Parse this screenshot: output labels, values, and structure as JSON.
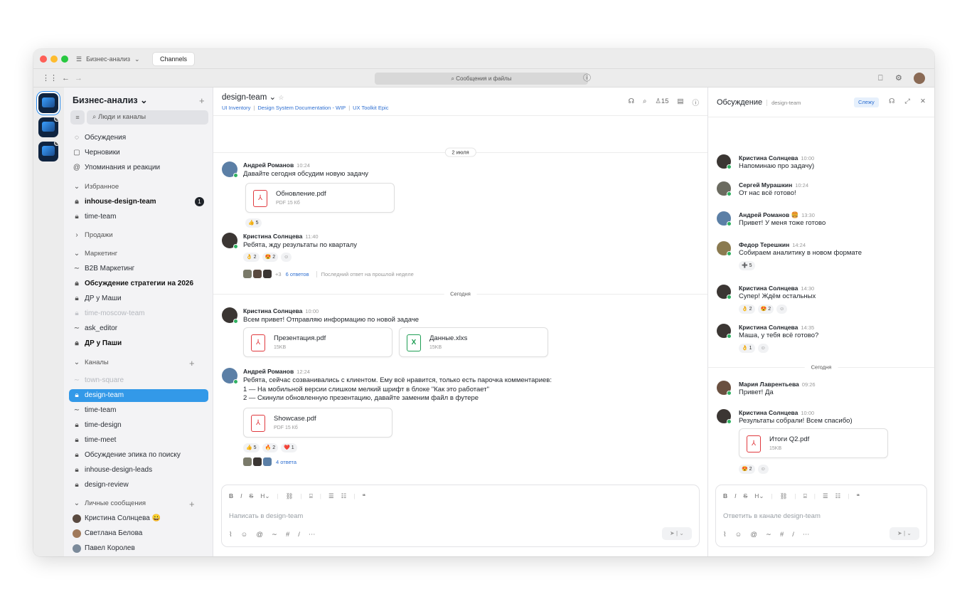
{
  "titlebar": {
    "workspace": "Бизнес-анализ",
    "tab": "Channels"
  },
  "toolbar": {
    "search_placeholder": "Сообщения и файлы"
  },
  "sidebar": {
    "title": "Бизнес-анализ",
    "search_placeholder": "Люди и каналы",
    "top": [
      "Обсуждения",
      "Черновики",
      "Упоминания и реакции"
    ],
    "favorites_label": "Избранное",
    "favorites": [
      {
        "label": "inhouse-design-team",
        "badge": "1"
      },
      {
        "label": "time-team"
      }
    ],
    "sales_label": "Продажи",
    "marketing_label": "Маркетинг",
    "marketing": [
      "B2B Маркетинг",
      "Обсуждение стратегии на 2026",
      "ДР у Маши",
      "time-moscow-team",
      "ask_editor",
      "ДР у Паши"
    ],
    "channels_label": "Каналы",
    "channels": [
      "town-square",
      "design-team",
      "time-team",
      "time-design",
      "time-meet",
      "Обсуждение эпика по поиску",
      "inhouse-design-leads",
      "design-review"
    ],
    "dm_label": "Личные сообщения",
    "dms": [
      "Кристина Солнцева 😀",
      "Светлана Белова",
      "Павел Королев"
    ]
  },
  "channel": {
    "name": "design-team",
    "links": [
      "UI Inventory",
      "Design System Documentation - WIP",
      "UX Toolkit Epic"
    ],
    "members": "15",
    "date1": "2 июля",
    "date2": "Сегодня",
    "messages": [
      {
        "author": "Андрей Романов",
        "time": "10:24",
        "text": [
          "Давайте сегодня обсудим новую задачу"
        ],
        "files": [
          {
            "name": "Обновление.pdf",
            "size": "PDF 15 Кб"
          }
        ],
        "reactions": [
          "👍 5"
        ]
      },
      {
        "author": "Кристина Солнцева",
        "time": "11:40",
        "text": [
          "Ребята, жду результаты по кварталу"
        ],
        "reactions": [
          "👌 2",
          "😍 2"
        ],
        "thread": {
          "extra": "+3",
          "count": "6 ответов",
          "last": "Последний ответ на прошлой неделе"
        }
      },
      {
        "author": "Кристина Солнцева",
        "time": "10:00",
        "text": [
          "Всем привет! Отправляю информацию по новой задаче"
        ],
        "files": [
          {
            "name": "Презентация.pdf",
            "size": "15KB"
          },
          {
            "name": "Данные.xlxs",
            "size": "15KB"
          }
        ]
      },
      {
        "author": "Андрей Романов",
        "time": "12:24",
        "text": [
          "Ребята, сейчас созванивались с клиентом. Ему всё нравится, только есть парочка комментариев:",
          "1 — На мобильной версии слишком мелкий шрифт в блоке \"Как это работает\"",
          "2 — Скинули обновленную презентацию, давайте заменим файл в футере"
        ],
        "files": [
          {
            "name": "Showcase.pdf",
            "size": "PDF 15 Кб"
          }
        ],
        "reactions": [
          "👍 5",
          "🔥 2",
          "❤️ 1"
        ],
        "thread": {
          "count": "4 ответа"
        }
      }
    ],
    "composer_placeholder": "Написать в design-team"
  },
  "thread_panel": {
    "title": "Обсуждение",
    "channel": "design-team",
    "follow": "Слежу",
    "date": "Сегодня",
    "messages": [
      {
        "author": "Кристина Солнцева",
        "time": "10:00",
        "text": "Напоминаю про задачу)"
      },
      {
        "author": "Сергей Мурашкин",
        "time": "10:24",
        "text": "От нас всё готово!"
      },
      {
        "author": "Андрей Романов 🍔",
        "time": "13:30",
        "text": "Привет! У меня тоже готово"
      },
      {
        "author": "Федор Терешкин",
        "time": "14:24",
        "text": "Собираем аналитику в новом формате",
        "reactions": [
          "➕ 5"
        ]
      },
      {
        "author": "Кристина Солнцева",
        "time": "14:30",
        "text": "Супер! Ждём остальных",
        "reactions": [
          "👌 2",
          "😍 2"
        ]
      },
      {
        "author": "Кристина Солнцева",
        "time": "14:35",
        "text": "Маша, у тебя всё готово?",
        "reactions": [
          "👌 1"
        ]
      },
      {
        "author": "Мария Лаврентьева",
        "time": "09:26",
        "text": "Привет! Да"
      },
      {
        "author": "Кристина Солнцева",
        "time": "10:00",
        "text": "Результаты собрали! Всем спасибо)",
        "files": [
          {
            "name": "Итоги Q2.pdf",
            "size": "15KB"
          }
        ],
        "reactions": [
          "😍 2"
        ]
      }
    ],
    "composer_placeholder": "Ответить в канале design-team"
  }
}
